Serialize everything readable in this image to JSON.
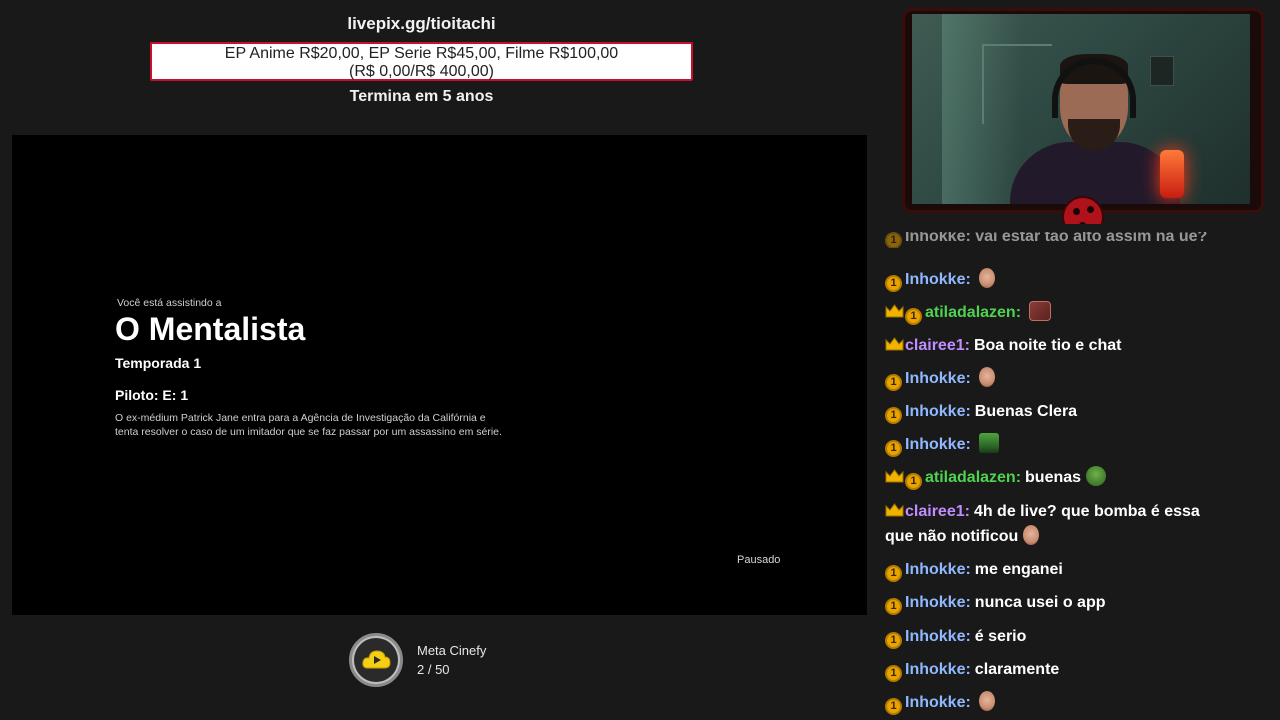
{
  "goal": {
    "url": "livepix.gg/tioitachi",
    "prices_line1": "EP Anime R$20,00, EP Serie R$45,00, Filme R$100,00",
    "prices_line2": "(R$ 0,00/R$ 400,00)",
    "ends": "Termina em 5 anos",
    "progress_fraction": 0.0
  },
  "player": {
    "watching_label": "Você está assistindo a",
    "title": "O Mentalista",
    "season": "Temporada 1",
    "episode": "Piloto: E: 1",
    "synopsis": "O ex-médium Patrick Jane entra para a Agência de Investigação da Califórnia e tenta resolver o caso de um imitador que se faz passar por um assassino em série.",
    "status": "Pausado"
  },
  "meta": {
    "label": "Meta Cinefy",
    "count": "2 / 50"
  },
  "chat": {
    "partial_top": "Inhokke: vai estar tão alto assim na ue?",
    "messages": [
      {
        "user": "Inhokke:",
        "color": "#8fb8ff",
        "badges": [
          "coin"
        ],
        "text": "",
        "emote": "face"
      },
      {
        "user": "atiladalazen:",
        "color": "#4fd24f",
        "badges": [
          "crown",
          "coin"
        ],
        "text": "",
        "emote": "pic"
      },
      {
        "user": "clairee1:",
        "color": "#c08cff",
        "badges": [
          "crown"
        ],
        "text": "Boa noite tio e chat",
        "emote": ""
      },
      {
        "user": "Inhokke:",
        "color": "#8fb8ff",
        "badges": [
          "coin"
        ],
        "text": "",
        "emote": "face"
      },
      {
        "user": "Inhokke:",
        "color": "#8fb8ff",
        "badges": [
          "coin"
        ],
        "text": "Buenas Clera",
        "emote": ""
      },
      {
        "user": "Inhokke:",
        "color": "#8fb8ff",
        "badges": [
          "coin"
        ],
        "text": "",
        "emote": "car"
      },
      {
        "user": "atiladalazen:",
        "color": "#4fd24f",
        "badges": [
          "crown",
          "coin"
        ],
        "text": "buenas",
        "emote": "pepe"
      },
      {
        "user": "clairee1:",
        "color": "#c08cff",
        "badges": [
          "crown"
        ],
        "text": "4h de live? que bomba é essa que não notificou",
        "emote": "face"
      },
      {
        "user": "Inhokke:",
        "color": "#8fb8ff",
        "badges": [
          "coin"
        ],
        "text": "me enganei",
        "emote": ""
      },
      {
        "user": "Inhokke:",
        "color": "#8fb8ff",
        "badges": [
          "coin"
        ],
        "text": "nunca usei o app",
        "emote": ""
      },
      {
        "user": "Inhokke:",
        "color": "#8fb8ff",
        "badges": [
          "coin"
        ],
        "text": "é serio",
        "emote": ""
      },
      {
        "user": "Inhokke:",
        "color": "#8fb8ff",
        "badges": [
          "coin"
        ],
        "text": "claramente",
        "emote": ""
      },
      {
        "user": "Inhokke:",
        "color": "#8fb8ff",
        "badges": [
          "coin"
        ],
        "text": "",
        "emote": "face"
      }
    ]
  }
}
